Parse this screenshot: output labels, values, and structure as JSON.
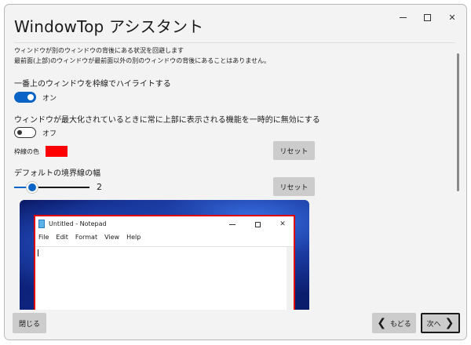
{
  "window": {
    "title": "WindowTop アシスタント",
    "close_glyph": "✕"
  },
  "description": {
    "line1": "ウィンドウが別のウィンドウの背後にある状況を回避します",
    "line2": "最前面(上部)のウィンドウが最前面以外の別のウィンドウの背後にあることはありません。"
  },
  "highlight": {
    "label": "一番上のウィンドウを枠線でハイライトする",
    "toggle_text": "オン",
    "enabled": true
  },
  "maximized": {
    "label": "ウィンドウが最大化されているときに常に上部に表示される機能を一時的に無効にする",
    "toggle_text": "オフ",
    "enabled": false
  },
  "border_color": {
    "label": "枠線の色",
    "value": "#ff0000",
    "reset_label": "リセット"
  },
  "border_width": {
    "label": "デフォルトの境界線の幅",
    "value": "2",
    "reset_label": "リセット"
  },
  "preview": {
    "notepad_title": "Untitled - Notepad",
    "menu": [
      "File",
      "Edit",
      "Format",
      "View",
      "Help"
    ],
    "close_glyph": "✕"
  },
  "footer": {
    "close_label": "閉じる",
    "back_label": "もどる",
    "next_label": "次へ",
    "back_glyph": "❮",
    "next_glyph": "❯"
  }
}
